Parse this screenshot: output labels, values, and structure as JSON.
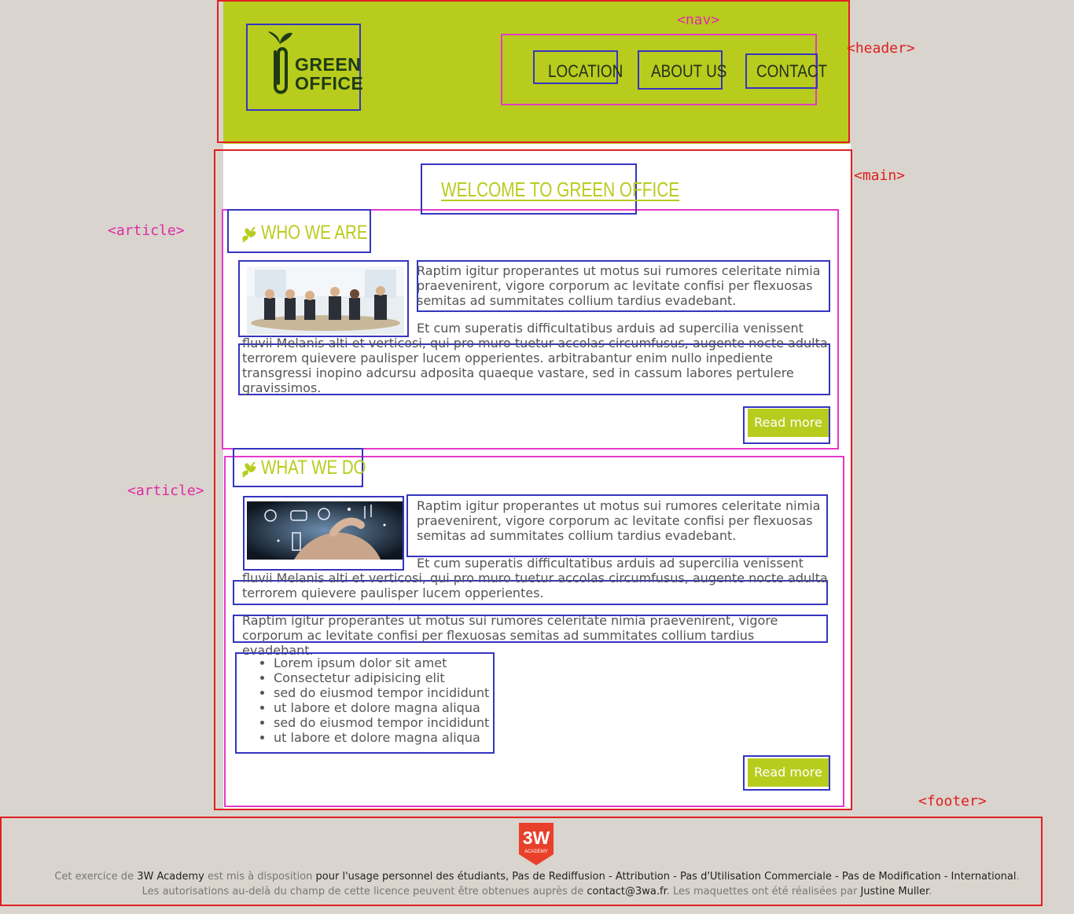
{
  "annotations": {
    "nav": "<nav>",
    "header": "<header>",
    "main": "<main>",
    "article": "<article>",
    "footer": "<footer>"
  },
  "logo": {
    "line1": "GREEN",
    "line2": "OFFICE"
  },
  "nav": {
    "items": [
      "LOCATION",
      "ABOUT US",
      "CONTACT"
    ]
  },
  "main": {
    "title": "WELCOME TO GREEN OFFICE",
    "articles": [
      {
        "title": "WHO WE ARE",
        "para1": "Raptim igitur properantes ut motus sui rumores celeritate nimia praevenirent, vigore corporum ac levitate confisi per flexuosas semitas ad summitates collium tardius evadebant.",
        "para2": "Et cum superatis difficultatibus arduis ad supercilia venissent fluvii Melanis alti et verticosi, qui pro muro tuetur accolas circumfusus, augente nocte adulta terrorem quievere paulisper lucem opperientes. arbitrabantur enim nullo inpediente transgressi inopino adcursu adposita quaeque vastare, sed in cassum labores pertulere gravissimos.",
        "button": "Read more"
      },
      {
        "title": "WHAT WE DO",
        "para1": "Raptim igitur properantes ut motus sui rumores celeritate nimia praevenirent, vigore corporum ac levitate confisi per flexuosas semitas ad summitates collium tardius evadebant.",
        "para2": "Et cum superatis difficultatibus arduis ad supercilia venissent fluvii Melanis alti et verticosi, qui pro muro tuetur accolas circumfusus, augente nocte adulta terrorem quievere paulisper lucem opperientes.",
        "para3": "Raptim igitur properantes ut motus sui rumores celeritate nimia praevenirent, vigore corporum ac levitate confisi per flexuosas semitas ad summitates collium tardius evadebant.",
        "list": [
          "Lorem ipsum dolor sit amet",
          "Consectetur adipisicing elit",
          "sed do eiusmod tempor incididunt",
          "ut labore et dolore magna aliqua",
          "sed do eiusmod tempor incididunt",
          "ut labore et dolore magna aliqua"
        ],
        "button": "Read more"
      }
    ]
  },
  "footer": {
    "badge_big": "3W",
    "badge_small": "ACADEMY",
    "line1": {
      "a": "Cet exercice de ",
      "b": "3W Academy",
      "c": " est mis à disposition ",
      "d": "pour l'usage personnel des étudiants, Pas de Rediffusion - Attribution - Pas d'Utilisation Commerciale - Pas de Modification - International",
      "e": "."
    },
    "line2": {
      "a": "Les autorisations au-delà du champ de cette licence peuvent être obtenues auprès de ",
      "b": "contact@3wa.fr",
      "c": ". Les maquettes ont été réalisées par ",
      "d": "Justine Muller",
      "e": "."
    }
  },
  "colors": {
    "accent": "#b8cc1e",
    "annotation_red": "#e02020",
    "annotation_pink": "#e43ac8",
    "annotation_blue": "#3535c0",
    "footer_badge": "#e8402a"
  }
}
